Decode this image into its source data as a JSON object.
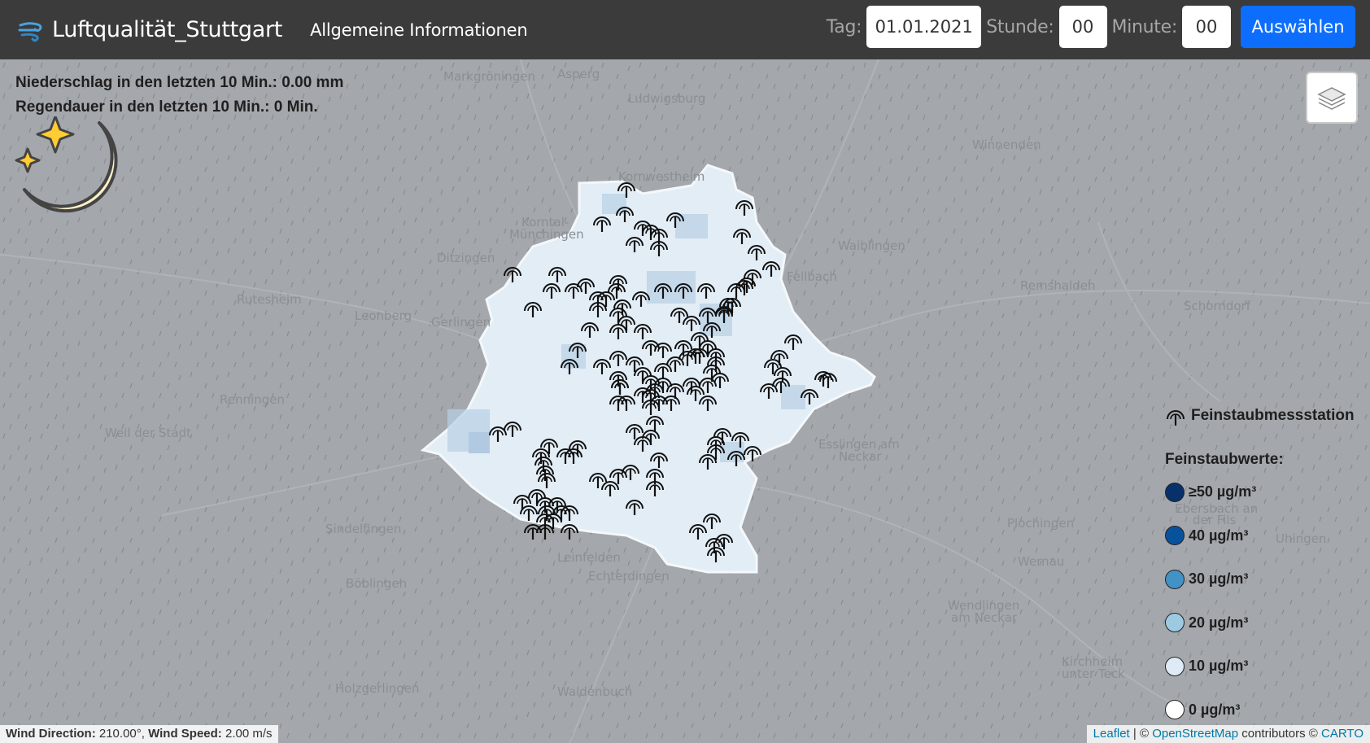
{
  "navbar": {
    "brand": "Luftqualität_Stuttgart",
    "brand_icon": "wind-logo-icon",
    "link_general": "Allgemeine Informationen",
    "day_label": "Tag:",
    "day_value": "01.01.2021",
    "hour_label": "Stunde:",
    "hour_value": "00",
    "minute_label": "Minute:",
    "minute_value": "00",
    "select_button": "Auswählen"
  },
  "weather": {
    "precipitation": "Niederschlag in den letzten 10 Min.: 0.00 mm",
    "rain_duration": "Regendauer in den letzten 10 Min.: 0 Min.",
    "icon": "moon-stars-icon"
  },
  "places": [
    "Markgröningen",
    "Asperg",
    "Ludwigsburg",
    "Winnenden",
    "Kornwestheim",
    "Korntal-",
    "Münchingen",
    "Ditzingen",
    "Waiblingen",
    "Fellbach",
    "Remshalden",
    "Schorndorf",
    "Rutesheim",
    "Leonberg",
    "Gerlingen",
    "Renningen",
    "Weil der Stadt",
    "Esslingen am",
    "Neckar",
    "Ebersbach an",
    "der Fils",
    "Plochingen",
    "Uhingen",
    "Wernau",
    "Sindelfingen",
    "Leinfelden",
    "Echterdingen",
    "Böblingen",
    "Wendlingen",
    "am Neckar",
    "Kirchheim",
    "unter Teck",
    "Holzgerlingen",
    "Waldenbuch"
  ],
  "legend": {
    "station_label": "Feinstaubmessstation",
    "station_icon": "sensor-station-icon",
    "title": "Feinstaubwerte:",
    "items": [
      {
        "label": "≥50 µg/m³",
        "color": "#08306b"
      },
      {
        "label": "40 µg/m³",
        "color": "#08519c"
      },
      {
        "label": "30 µg/m³",
        "color": "#4292c6"
      },
      {
        "label": "20 µg/m³",
        "color": "#9ecae1"
      },
      {
        "label": "10 µg/m³",
        "color": "#deebf7"
      },
      {
        "label": "0 µg/m³",
        "color": "#ffffff"
      }
    ]
  },
  "wind": {
    "direction_label": "Wind Direction:",
    "direction_value": "210.00°",
    "speed_label": "Wind Speed:",
    "speed_value": "2.00 m/s"
  },
  "attribution": {
    "leaflet": "Leaflet",
    "sep": "| ©",
    "osm": "OpenStreetMap",
    "contributors": "contributors ©",
    "carto": "CARTO"
  },
  "colors": {
    "navbar": "#3b3b3b",
    "accent": "#0d6efd",
    "map_bg": "#a3a7ab",
    "city_fill": "#e3edf6"
  }
}
